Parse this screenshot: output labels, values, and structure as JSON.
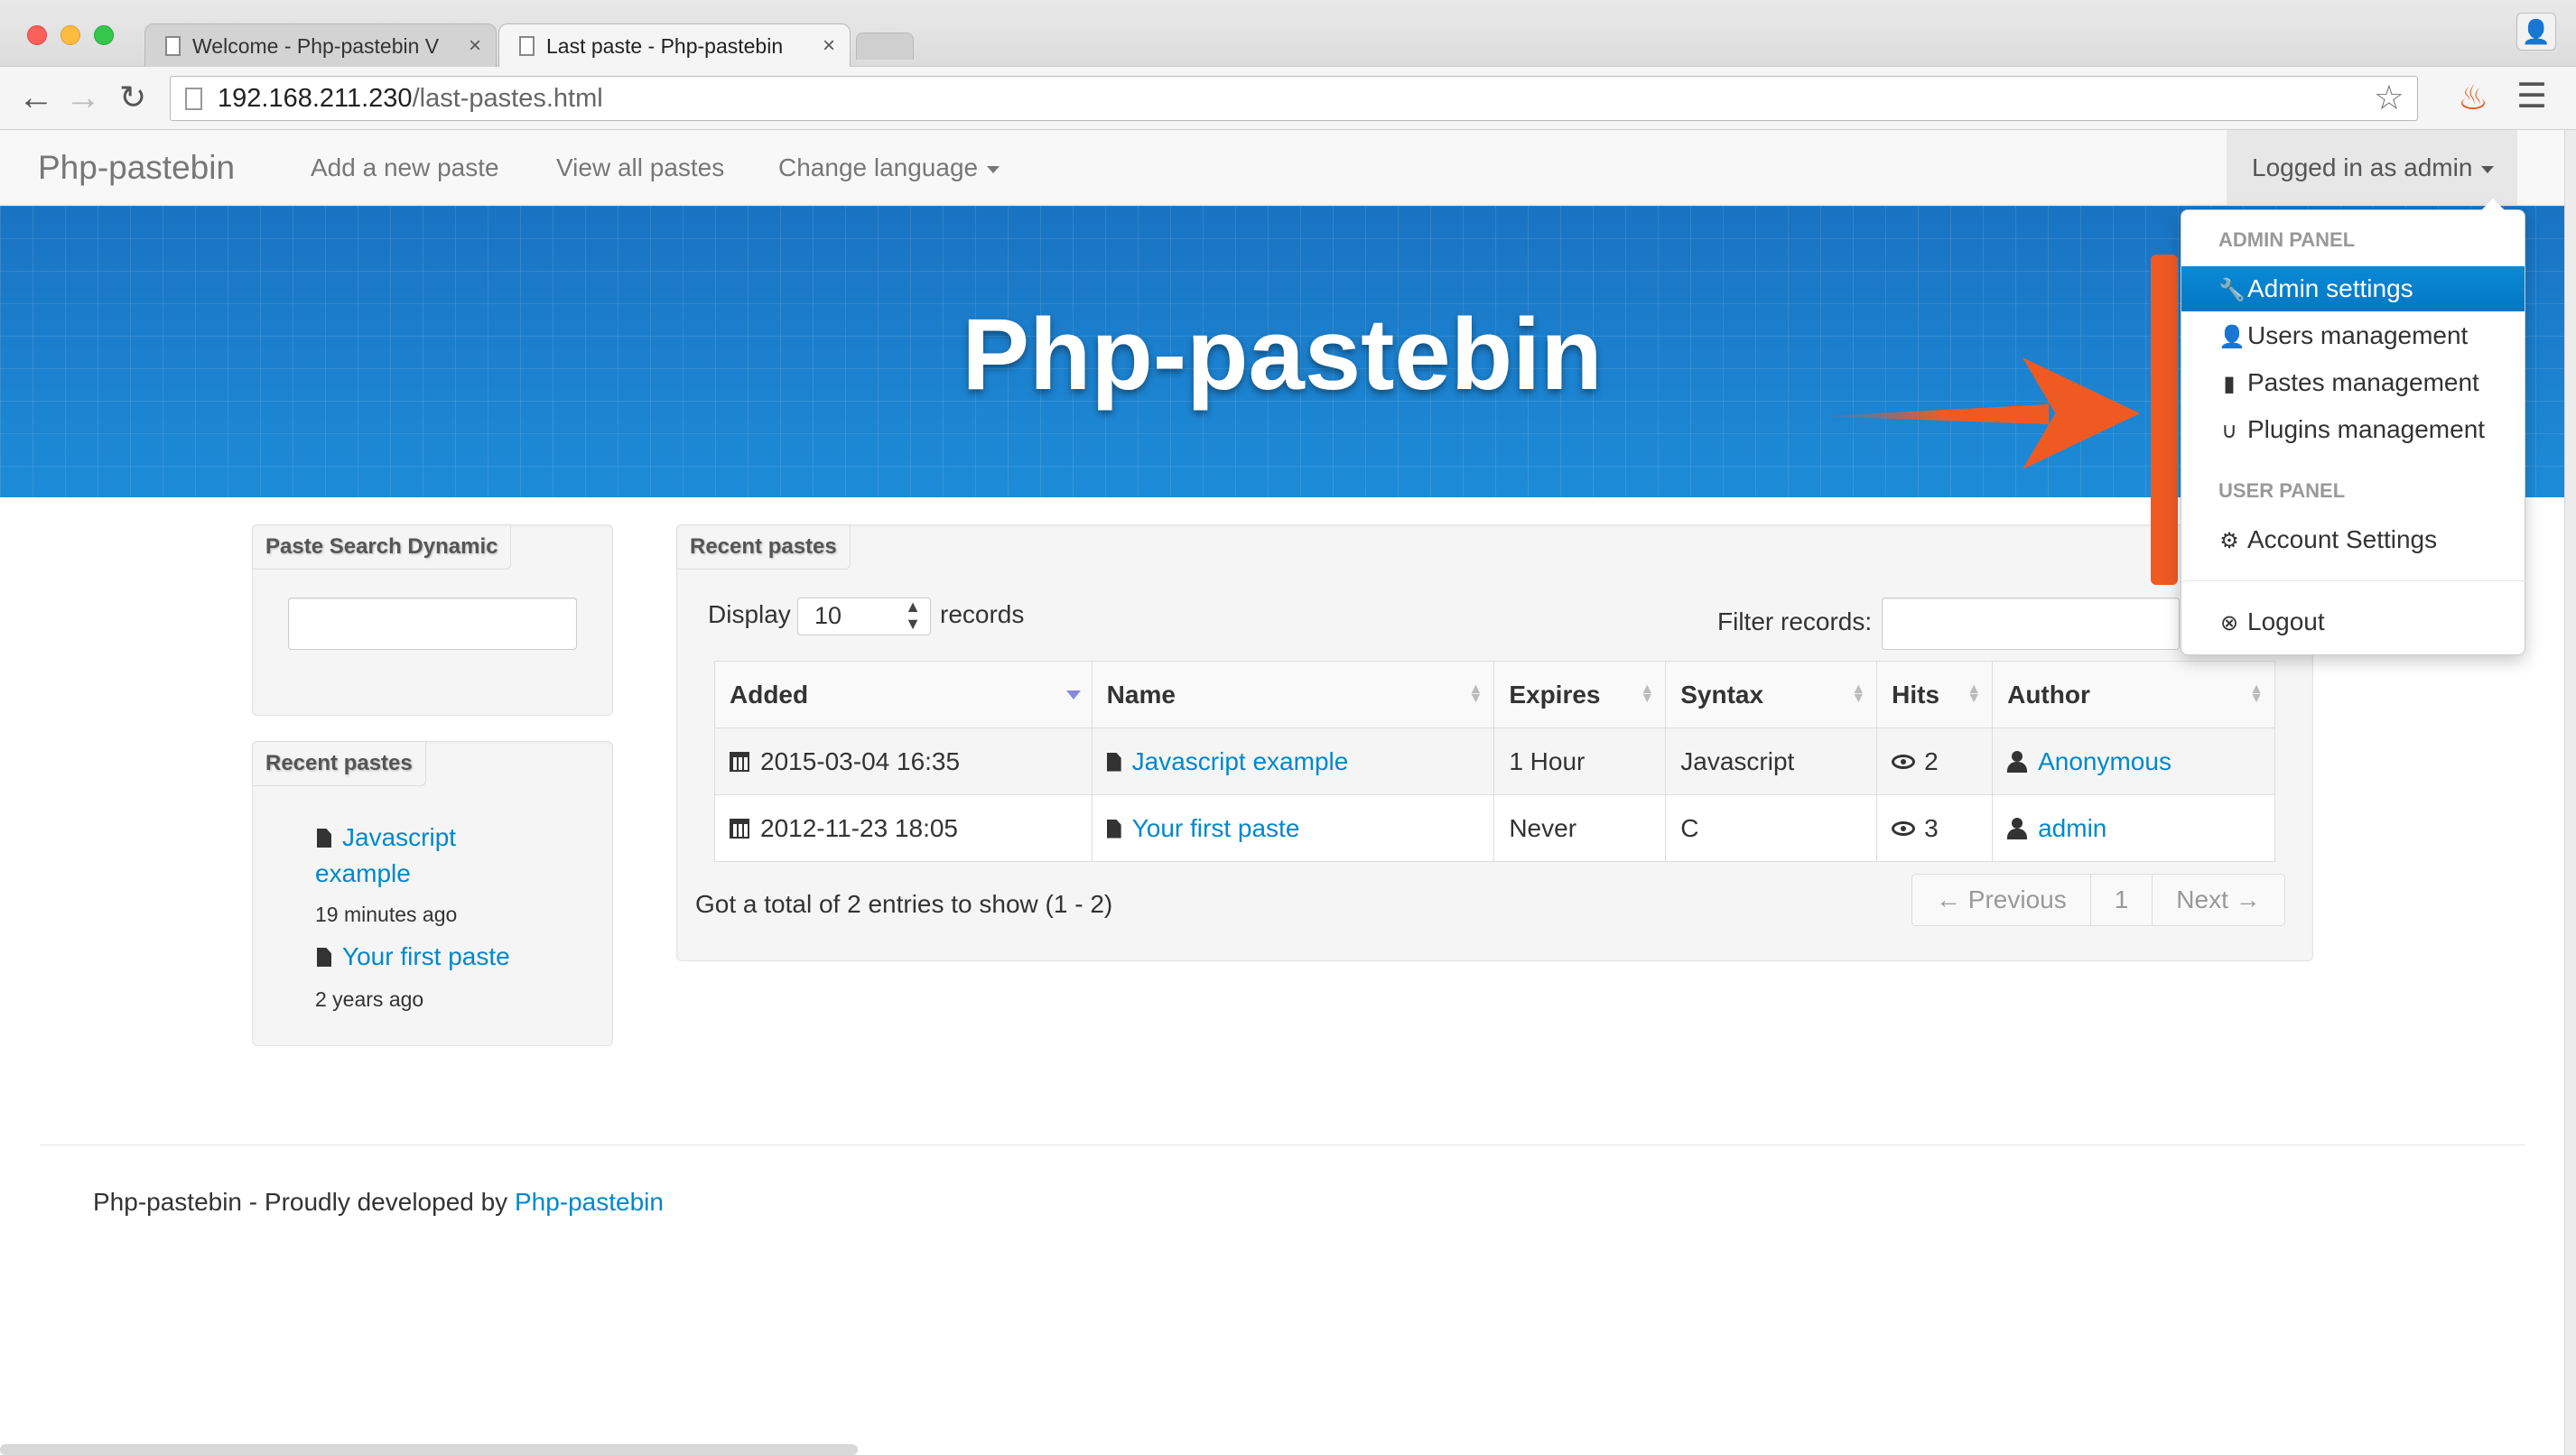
{
  "browser": {
    "tabs": [
      {
        "title": "Welcome - Php-pastebin V",
        "active": false
      },
      {
        "title": "Last paste - Php-pastebin",
        "active": true
      }
    ],
    "url_host": "192.168.211.230",
    "url_path": "/last-pastes.html"
  },
  "navbar": {
    "brand": "Php-pastebin",
    "links": [
      "Add a new paste",
      "View all pastes",
      "Change language"
    ],
    "user_menu": "Logged in as admin"
  },
  "banner": {
    "title": "Php-pastebin"
  },
  "dropdown": {
    "admin_header": "ADMIN PANEL",
    "admin_items": [
      "Admin settings",
      "Users management",
      "Pastes management",
      "Plugins management"
    ],
    "user_header": "USER PANEL",
    "user_items": [
      "Account Settings"
    ],
    "logout": "Logout"
  },
  "sidebar": {
    "search_title": "Paste Search Dynamic",
    "recent_title": "Recent pastes",
    "recent": [
      {
        "title_line1": "Javascript",
        "title_line2": "example",
        "time": "19 minutes ago"
      },
      {
        "title": "Your first paste",
        "time": "2 years ago"
      }
    ]
  },
  "main": {
    "title": "Recent pastes",
    "display_label": "Display",
    "display_value": "10",
    "records_label": "records",
    "filter_label": "Filter records:",
    "columns": [
      "Added",
      "Name",
      "Expires",
      "Syntax",
      "Hits",
      "Author"
    ],
    "rows": [
      {
        "added": "2015-03-04 16:35",
        "name": "Javascript example",
        "expires": "1 Hour",
        "syntax": "Javascript",
        "hits": "2",
        "author": "Anonymous"
      },
      {
        "added": "2012-11-23 18:05",
        "name": "Your first paste",
        "expires": "Never",
        "syntax": "C",
        "hits": "3",
        "author": "admin"
      }
    ],
    "summary": "Got a total of 2 entries to show (1 - 2)",
    "pager": {
      "previous": "← Previous",
      "page": "1",
      "next": "Next →"
    }
  },
  "footer": {
    "text": "Php-pastebin - Proudly developed by ",
    "link": "Php-pastebin"
  },
  "colors": {
    "accent": "#0088cc",
    "banner": "#1b7fcc",
    "annotation": "#ef5a23"
  }
}
